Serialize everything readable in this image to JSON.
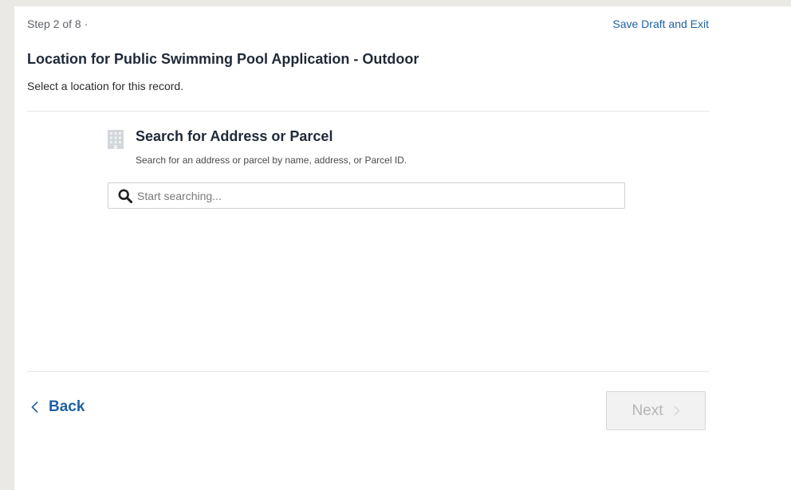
{
  "header": {
    "step_text": "Step 2 of 8 ·",
    "save_exit_label": "Save Draft and Exit"
  },
  "page": {
    "title": "Location for Public Swimming Pool Application - Outdoor",
    "subtitle": "Select a location for this record."
  },
  "search_section": {
    "icon": "building-icon",
    "title": "Search for Address or Parcel",
    "help_text": "Search for an address or parcel by name, address, or Parcel ID.",
    "search": {
      "icon": "search-icon",
      "placeholder": "Start searching...",
      "value": ""
    }
  },
  "footer": {
    "back_label": "Back",
    "next_label": "Next",
    "next_disabled": true
  },
  "colors": {
    "link_blue": "#1f62a5",
    "title_text": "#1f2a38",
    "disabled_text": "#b5b5b5",
    "page_background": "#ebe9e5"
  }
}
